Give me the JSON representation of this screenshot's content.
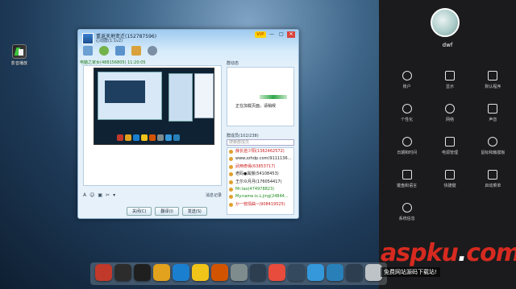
{
  "desktop": {
    "icon_label": "影音播放"
  },
  "qq_window": {
    "title": "重返天地变迁(152787596)",
    "subtitle": "心动群(1:1v2)",
    "vip_badge": "VIP",
    "minimize": "—",
    "maximize": "□",
    "close": "✕",
    "contact_line": "电脑之家女(488156805)  11:20:05",
    "font_tool": "A",
    "emoji_tool": "☺",
    "history_label": "消息记录",
    "close_btn": "关闭(C)",
    "translate_btn": "翻译(I)",
    "send_btn": "发送(S)",
    "group_dynamic": "群动态",
    "loading_text": "正在加载页面，请稍候",
    "members_header": "群成员(102/238)",
    "search_placeholder": "搜索群成员",
    "members": [
      {
        "name": "薛长途少阳(1362462572)",
        "color": "red"
      },
      {
        "name": "www.zzhdp.com(9111136...",
        "color": "dark"
      },
      {
        "name": "武两奇缘(63853717)",
        "color": "red"
      },
      {
        "name": "老码●属猴(54108453)",
        "color": "dark"
      },
      {
        "name": "王尔众月月(176054417)",
        "color": "dark"
      },
      {
        "name": "Mr.tao(474978823)",
        "color": "green"
      },
      {
        "name": "My.name.is.L.jing(24844...",
        "color": "green"
      },
      {
        "name": "か一枝情曲~(908419525)",
        "color": "red"
      }
    ]
  },
  "panel": {
    "user_name": "dwf",
    "items": [
      {
        "label": "账户",
        "icon": "user-icon"
      },
      {
        "label": "显示",
        "icon": "monitor-icon"
      },
      {
        "label": "默认程序",
        "icon": "checkbox-icon"
      },
      {
        "label": "个性化",
        "icon": "brush-icon"
      },
      {
        "label": "网络",
        "icon": "globe-icon"
      },
      {
        "label": "声音",
        "icon": "speaker-icon"
      },
      {
        "label": "日期和时间",
        "icon": "clock-icon"
      },
      {
        "label": "电源管理",
        "icon": "power-icon"
      },
      {
        "label": "鼠标和触摸板",
        "icon": "mouse-icon"
      },
      {
        "label": "键盘和语言",
        "icon": "keyboard-icon"
      },
      {
        "label": "快捷键",
        "icon": "fn-key-icon"
      },
      {
        "label": "启动菜单",
        "icon": "boot-menu-icon"
      },
      {
        "label": "系统信息",
        "icon": "info-icon"
      }
    ]
  },
  "dock": {
    "apps": [
      {
        "name": "launcher-app",
        "color": "#c0392b"
      },
      {
        "name": "desktop-app",
        "color": "#2c2c2c"
      },
      {
        "name": "window-app",
        "color": "#1f1f1f"
      },
      {
        "name": "game-center-app",
        "color": "#e2a21e"
      },
      {
        "name": "browser-app",
        "color": "#1b7fd0"
      },
      {
        "name": "chrome-app",
        "color": "#f0c419"
      },
      {
        "name": "music-app",
        "color": "#d35400"
      },
      {
        "name": "settings-app",
        "color": "#7f8c8d"
      },
      {
        "name": "file-manager-app",
        "color": "#2c3e50"
      },
      {
        "name": "photo-app",
        "color": "#e74c3c"
      },
      {
        "name": "terminal-app",
        "color": "#34495e"
      },
      {
        "name": "store-app",
        "color": "#3498db"
      },
      {
        "name": "qq-app",
        "color": "#2980b9"
      },
      {
        "name": "camera-app",
        "color": "#2c3e50"
      },
      {
        "name": "trash-app",
        "color": "#bdc3c7"
      }
    ]
  },
  "watermark": {
    "brand_a": "asp",
    "brand_b": "ku",
    "brand_dot": ".",
    "brand_c": "com",
    "slogan": "免费网站源码下载站!"
  }
}
